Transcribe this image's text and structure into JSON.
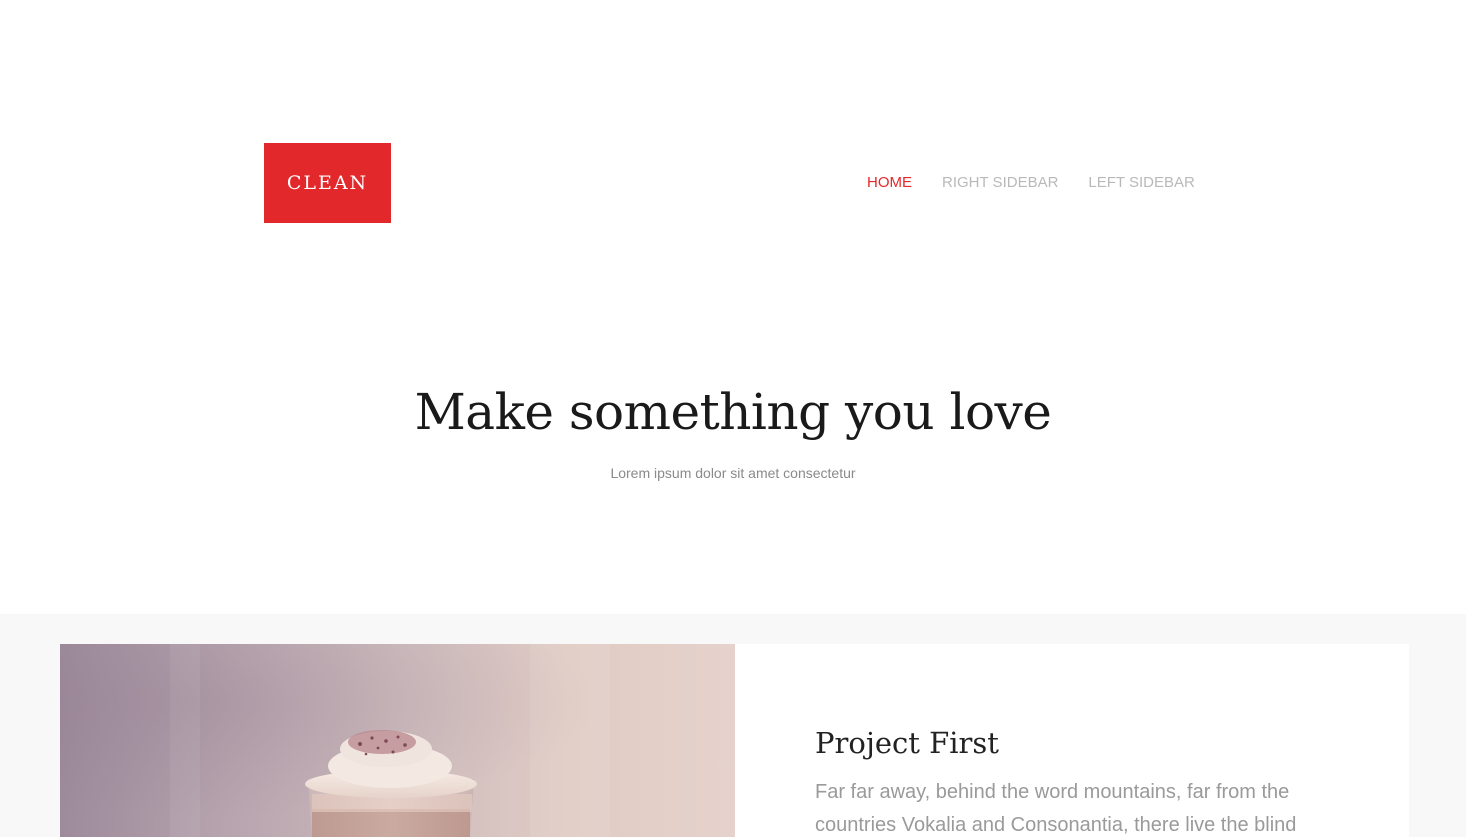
{
  "header": {
    "logo_text": "CLEAN",
    "nav": [
      {
        "label": "HOME",
        "active": true
      },
      {
        "label": "RIGHT SIDEBAR",
        "active": false
      },
      {
        "label": "LEFT SIDEBAR",
        "active": false
      }
    ]
  },
  "hero": {
    "title": "Make something you love",
    "subtitle": "Lorem ipsum dolor sit amet consectetur"
  },
  "project": {
    "title": "Project First",
    "text": "Far far away, behind the word mountains, far from the countries Vokalia and Consonantia, there live the blind"
  },
  "colors": {
    "accent": "#e3282b",
    "nav_inactive": "#b9b9b9",
    "section_bg": "#f8f8f8"
  }
}
